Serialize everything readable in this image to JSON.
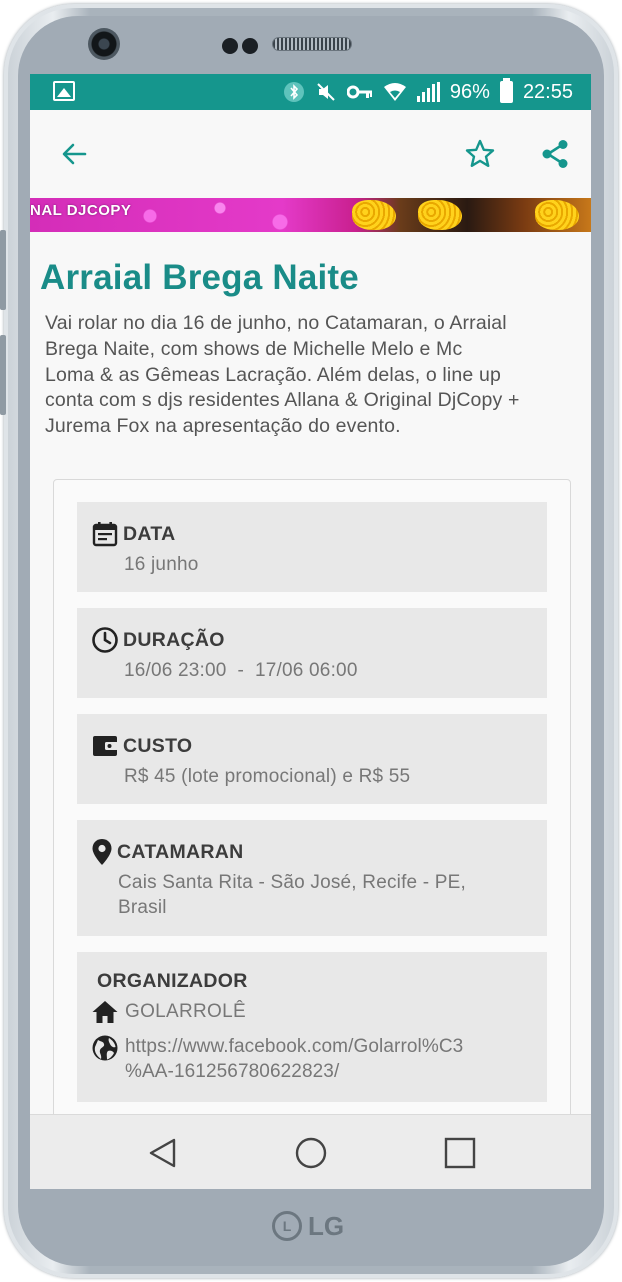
{
  "device": {
    "brand": "LG"
  },
  "status_bar": {
    "battery": "96%",
    "time": "22:55",
    "icons": [
      "image-icon",
      "bluetooth-icon",
      "mute-icon",
      "key-icon",
      "wifi-icon",
      "signal-icon",
      "battery-icon"
    ]
  },
  "app_bar": {
    "back_icon": "arrow-left-icon",
    "favorite_icon": "star-outline-icon",
    "share_icon": "share-icon"
  },
  "banner": {
    "visible_text": "NAL DJCOPY"
  },
  "event": {
    "title": "Arraial Brega Naite",
    "description_lines": [
      "Vai rolar no dia 16 de junho, no Catamaran, o Arraial",
      "Brega Naite, com shows de Michelle Melo e Mc",
      "Loma & as Gêmeas Lacração. Além delas, o line up",
      "conta com s djs residentes Allana & Original DjCopy +",
      "Jurema Fox na apresentação do evento."
    ]
  },
  "details": {
    "date": {
      "label": "DATA",
      "value": "16 junho"
    },
    "duration": {
      "label": "DURAÇÃO",
      "value": "16/06 23:00  -  17/06 06:00"
    },
    "cost": {
      "label": "CUSTO",
      "value": "R$ 45 (lote promocional) e R$ 55"
    },
    "location": {
      "label": "CATAMARAN",
      "address_line1": "Cais Santa Rita - São José, Recife - PE,",
      "address_line2": "Brasil"
    },
    "organizer": {
      "label": "ORGANIZADOR",
      "name": "GOLARROLÊ",
      "url_line1": "https://www.facebook.com/Golarrol%C3",
      "url_line2": "%AA-161256780622823/"
    }
  },
  "colors": {
    "accent": "#1a8c88",
    "status_bar": "#15968d",
    "block_bg": "#e8e8e8"
  },
  "nav": {
    "back_icon": "triangle-back-icon",
    "home_icon": "circle-home-icon",
    "recents_icon": "square-recents-icon"
  }
}
